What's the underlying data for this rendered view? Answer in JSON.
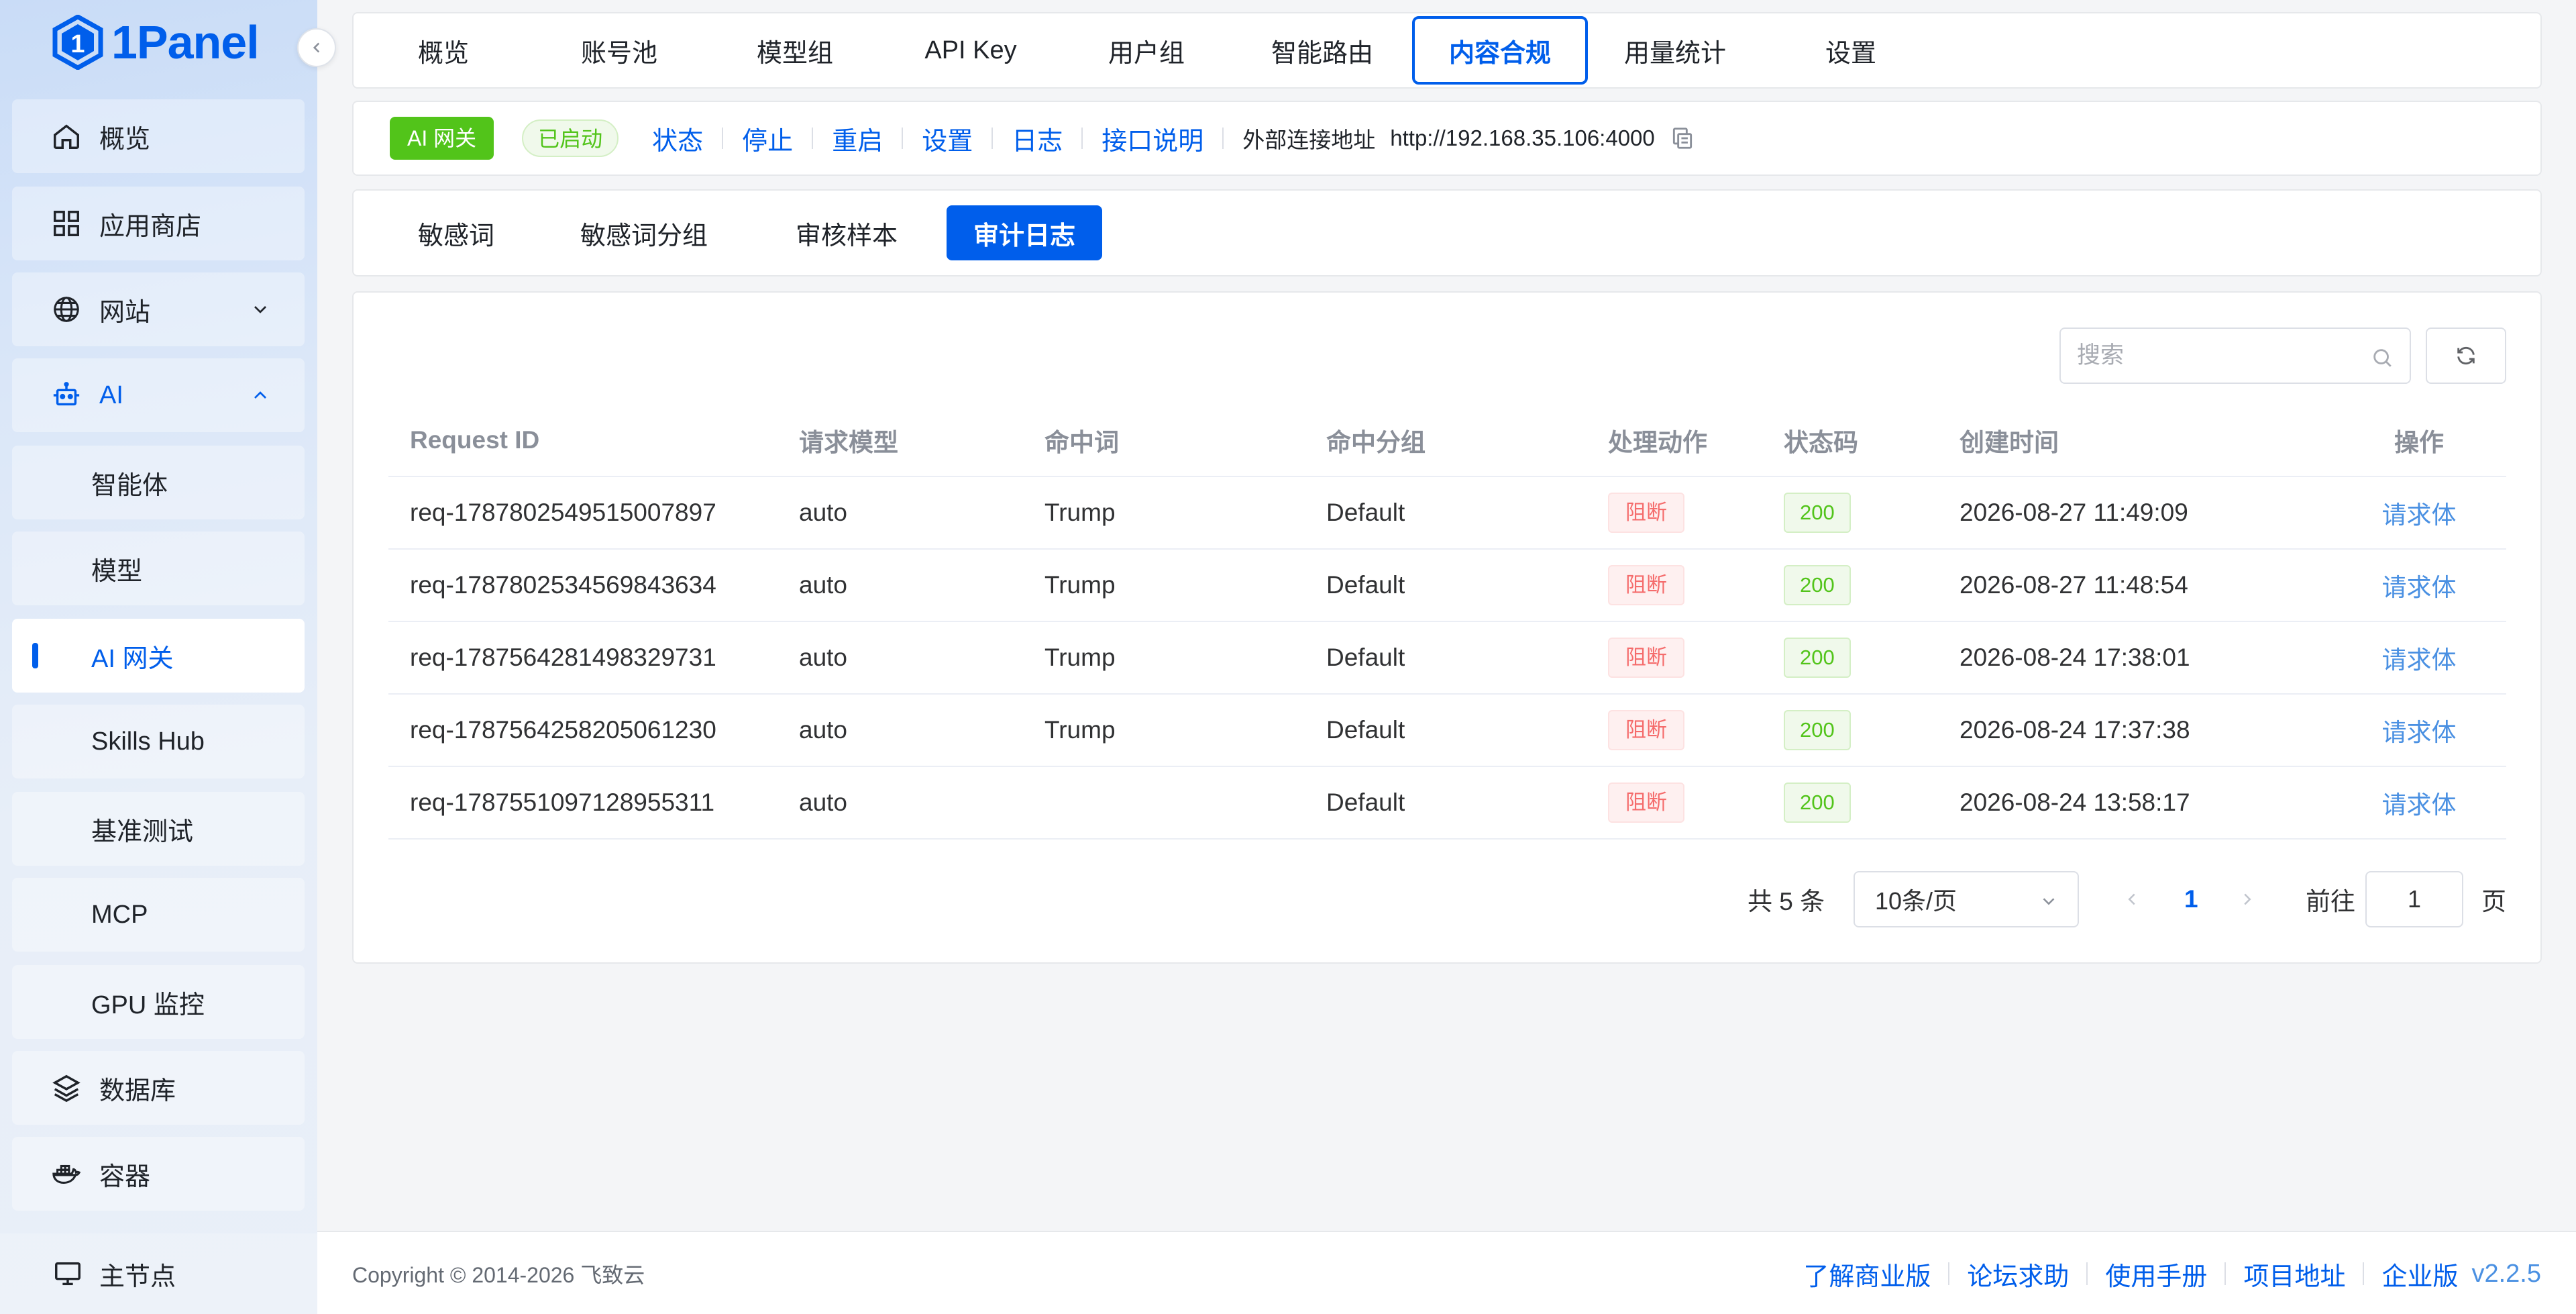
{
  "brand": {
    "logo_text": "1Panel"
  },
  "sidebar": {
    "items": [
      {
        "label": "概览",
        "icon": "home-icon"
      },
      {
        "label": "应用商店",
        "icon": "grid-icon"
      },
      {
        "label": "网站",
        "icon": "globe-icon"
      },
      {
        "label": "AI",
        "icon": "robot-icon"
      },
      {
        "label": "智能体"
      },
      {
        "label": "模型"
      },
      {
        "label": "AI 网关"
      },
      {
        "label": "Skills Hub"
      },
      {
        "label": "基准测试"
      },
      {
        "label": "MCP"
      },
      {
        "label": "GPU 监控"
      },
      {
        "label": "数据库",
        "icon": "layers-icon"
      },
      {
        "label": "容器",
        "icon": "docker-icon"
      }
    ],
    "bottom": {
      "label": "主节点",
      "icon": "monitor-icon"
    }
  },
  "top_tabs": [
    "概览",
    "账号池",
    "模型组",
    "API Key",
    "用户组",
    "智能路由",
    "内容合规",
    "用量统计",
    "设置"
  ],
  "status_bar": {
    "app_badge": "AI 网关",
    "state": "已启动",
    "actions": [
      "状态",
      "停止",
      "重启",
      "设置",
      "日志",
      "接口说明"
    ],
    "external_label": "外部连接地址",
    "external_url": "http://192.168.35.106:4000"
  },
  "sub_tabs": [
    "敏感词",
    "敏感词分组",
    "审核样本",
    "审计日志"
  ],
  "search": {
    "placeholder": "搜索"
  },
  "table": {
    "headers": [
      "Request ID",
      "请求模型",
      "命中词",
      "命中分组",
      "处理动作",
      "状态码",
      "创建时间",
      "操作"
    ],
    "rows": [
      {
        "request_id": "req-1787802549515007897",
        "model": "auto",
        "word": "Trump",
        "group": "Default",
        "action": "阻断",
        "status": "200",
        "created": "2026-08-27 11:49:09",
        "op": "请求体"
      },
      {
        "request_id": "req-1787802534569843634",
        "model": "auto",
        "word": "Trump",
        "group": "Default",
        "action": "阻断",
        "status": "200",
        "created": "2026-08-27 11:48:54",
        "op": "请求体"
      },
      {
        "request_id": "req-1787564281498329731",
        "model": "auto",
        "word": "Trump",
        "group": "Default",
        "action": "阻断",
        "status": "200",
        "created": "2026-08-24 17:38:01",
        "op": "请求体"
      },
      {
        "request_id": "req-1787564258205061230",
        "model": "auto",
        "word": "Trump",
        "group": "Default",
        "action": "阻断",
        "status": "200",
        "created": "2026-08-24 17:37:38",
        "op": "请求体"
      },
      {
        "request_id": "req-1787551097128955311",
        "model": "auto",
        "word": "",
        "group": "Default",
        "action": "阻断",
        "status": "200",
        "created": "2026-08-24 13:58:17",
        "op": "请求体"
      }
    ]
  },
  "pagination": {
    "total_text": "共 5 条",
    "page_size": "10条/页",
    "current_page": "1",
    "goto_label": "前往",
    "goto_value": "1",
    "page_suffix": "页"
  },
  "footer": {
    "copyright": "Copyright © 2014-2026 飞致云",
    "links": [
      "了解商业版",
      "论坛求助",
      "使用手册",
      "项目地址",
      "企业版"
    ],
    "version": "v2.2.5"
  },
  "colors": {
    "primary": "#005eeb",
    "success": "#52c41a",
    "danger": "#f56c6c"
  }
}
